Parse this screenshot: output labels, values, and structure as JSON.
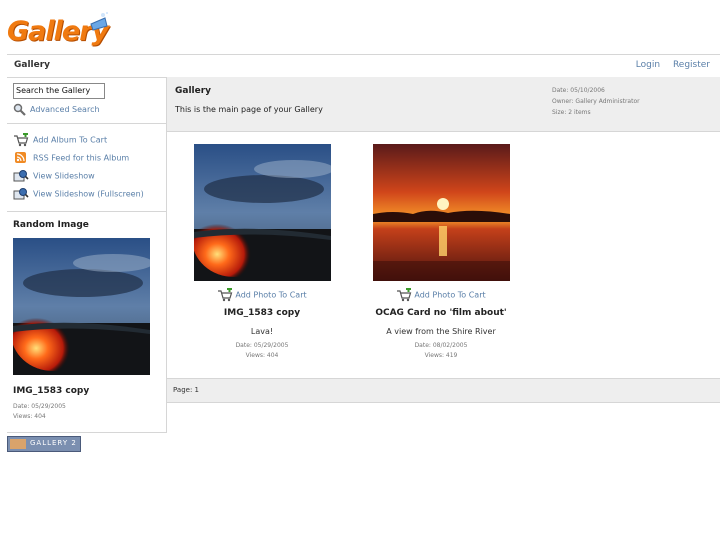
{
  "logo": {
    "text": "Gallery"
  },
  "breadcrumb": "Gallery",
  "user_links": {
    "login": "Login",
    "register": "Register"
  },
  "sidebar": {
    "search_value": "Search the Gallery",
    "advanced_search": "Advanced Search",
    "actions": [
      {
        "label": "Add Album To Cart",
        "icon": "cart-add-icon"
      },
      {
        "label": "RSS Feed for this Album",
        "icon": "rss-icon"
      },
      {
        "label": "View Slideshow",
        "icon": "slideshow-icon"
      },
      {
        "label": "View Slideshow (Fullscreen)",
        "icon": "slideshow-fullscreen-icon"
      }
    ],
    "random_image": {
      "heading": "Random Image",
      "name": "IMG_1583 copy",
      "date": "Date: 05/29/2005",
      "views": "Views: 404"
    }
  },
  "album": {
    "title": "Gallery",
    "description": "This is the main page of your Gallery",
    "date": "Date: 05/10/2006",
    "owner": "Owner: Gallery Administrator",
    "size": "Size: 2 items"
  },
  "items": [
    {
      "cart_label": "Add Photo To Cart",
      "title": "IMG_1583 copy",
      "description": "Lava!",
      "date": "Date: 05/29/2005",
      "views": "Views: 404"
    },
    {
      "cart_label": "Add Photo To Cart",
      "title": "OCAG Card no 'film about'",
      "description": "A view from the Shire River",
      "date": "Date: 08/02/2005",
      "views": "Views: 419"
    }
  ],
  "pager": {
    "label": "Page:",
    "current": "1"
  },
  "badge": {
    "text": "GALLERY 2"
  },
  "colors": {
    "link": "#5a7fa8",
    "accent": "#f07a10",
    "panel": "#eeeeee",
    "border": "#d6d6d6"
  }
}
